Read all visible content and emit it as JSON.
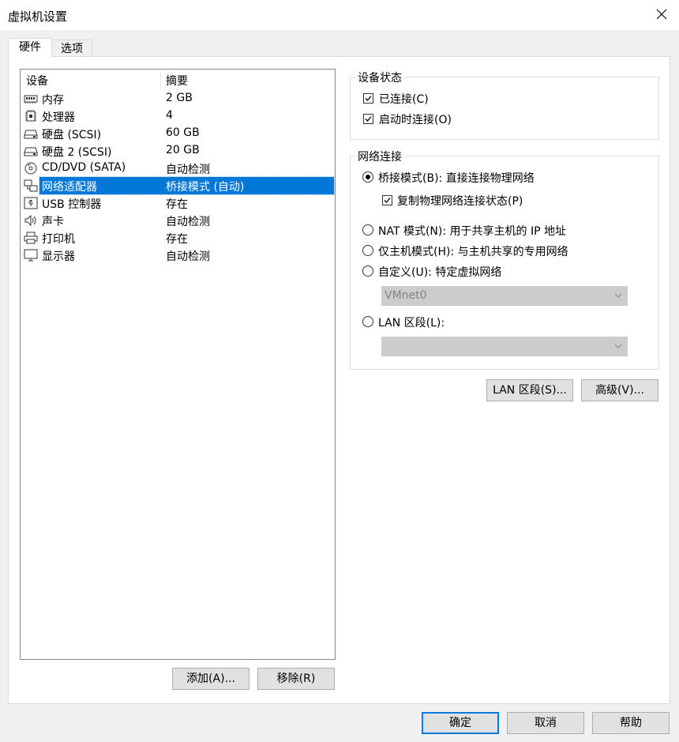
{
  "window": {
    "title": "虚拟机设置"
  },
  "tabs": [
    {
      "label": "硬件",
      "active": true
    },
    {
      "label": "选项",
      "active": false
    }
  ],
  "device_list": {
    "columns": [
      "设备",
      "摘要"
    ],
    "rows": [
      {
        "name": "内存",
        "summary": "2 GB",
        "icon": "memory-icon"
      },
      {
        "name": "处理器",
        "summary": "4",
        "icon": "processor-icon"
      },
      {
        "name": "硬盘 (SCSI)",
        "summary": "60 GB",
        "icon": "hard-disk-icon"
      },
      {
        "name": "硬盘 2 (SCSI)",
        "summary": "20 GB",
        "icon": "hard-disk-icon"
      },
      {
        "name": "CD/DVD (SATA)",
        "summary": "自动检测",
        "icon": "cd-dvd-icon"
      },
      {
        "name": "网络适配器",
        "summary": "桥接模式 (自动)",
        "icon": "network-adapter-icon",
        "selected": true
      },
      {
        "name": "USB 控制器",
        "summary": "存在",
        "icon": "usb-icon"
      },
      {
        "name": "声卡",
        "summary": "自动检测",
        "icon": "sound-card-icon"
      },
      {
        "name": "打印机",
        "summary": "存在",
        "icon": "printer-icon"
      },
      {
        "name": "显示器",
        "summary": "自动检测",
        "icon": "display-icon"
      }
    ]
  },
  "list_buttons": {
    "add": "添加(A)...",
    "remove": "移除(R)"
  },
  "device_status": {
    "title": "设备状态",
    "connected": {
      "label": "已连接(C)",
      "checked": true
    },
    "connect_at_power_on": {
      "label": "启动时连接(O)",
      "checked": true
    }
  },
  "network": {
    "title": "网络连接",
    "bridged": {
      "label": "桥接模式(B): 直接连接物理网络",
      "selected": true
    },
    "replicate": {
      "label": "复制物理网络连接状态(P)",
      "checked": true
    },
    "nat": {
      "label": "NAT 模式(N): 用于共享主机的 IP 地址",
      "selected": false
    },
    "host_only": {
      "label": "仅主机模式(H): 与主机共享的专用网络",
      "selected": false
    },
    "custom": {
      "label": "自定义(U): 特定虚拟网络",
      "selected": false,
      "value": "VMnet0"
    },
    "lan_segment": {
      "label": "LAN 区段(L):",
      "selected": false,
      "value": ""
    }
  },
  "network_buttons": {
    "lan_segments": "LAN 区段(S)...",
    "advanced": "高级(V)..."
  },
  "dialog_buttons": {
    "ok": "确定",
    "cancel": "取消",
    "help": "帮助"
  }
}
